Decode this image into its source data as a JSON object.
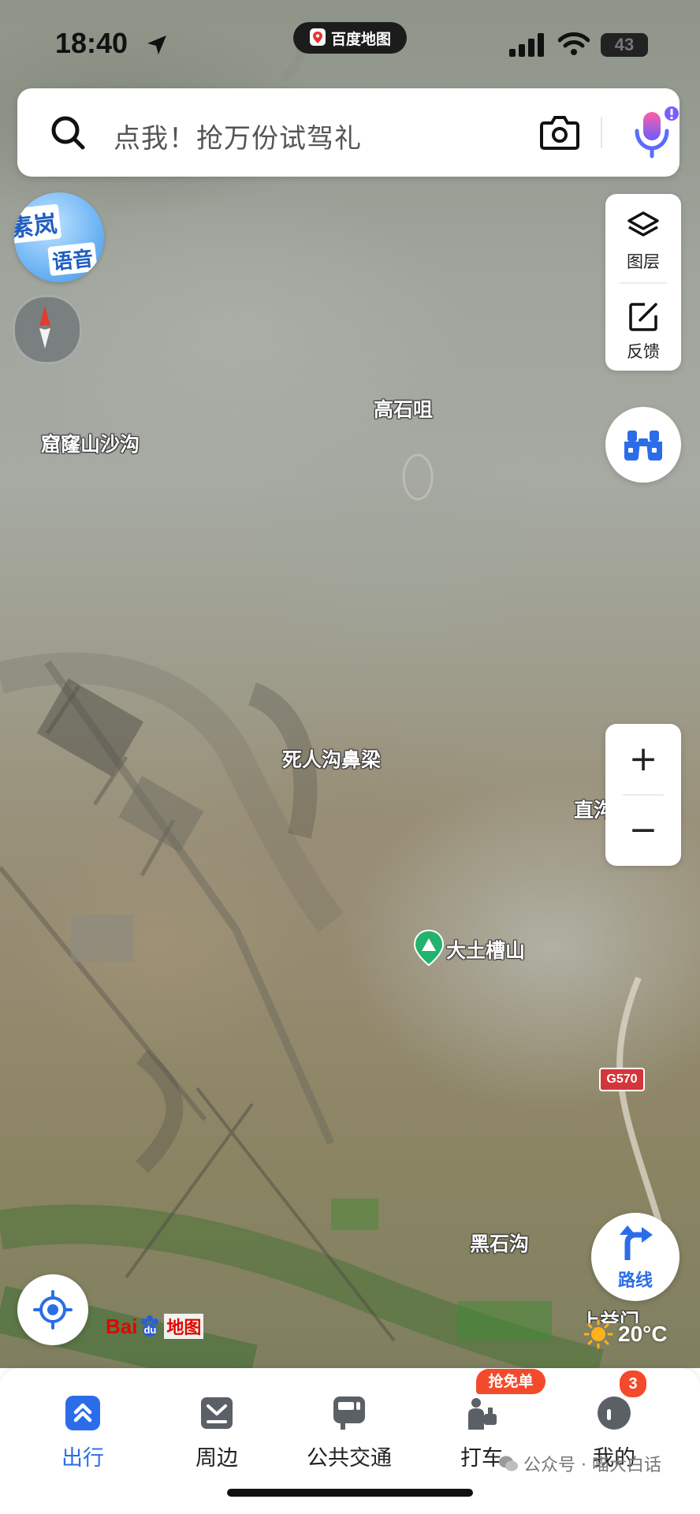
{
  "status_bar": {
    "time": "18:40",
    "battery": "43",
    "app_pill_label": "百度地图"
  },
  "search": {
    "placeholder": "点我！抢万份试驾礼"
  },
  "voice_bubble": {
    "line1": "素岚",
    "line2": "语音"
  },
  "layer_panel": {
    "layers_label": "图层",
    "feedback_label": "反馈"
  },
  "zoom": {
    "in_label": "+",
    "out_label": "−"
  },
  "route_button": {
    "label": "路线"
  },
  "map_labels": {
    "gaoshiju": "高石咀",
    "kulongshan": "窟窿山沙沟",
    "sirengou": "死人沟鼻梁",
    "zhi": "直沟",
    "datucaoshan": "大土槽山",
    "heishigou": "黑石沟",
    "shangyimen": "上益门",
    "road_shield": "G570"
  },
  "logo": {
    "part1": "Bai",
    "part2": "du",
    "part3": "地图"
  },
  "weather": {
    "temperature": "20°C"
  },
  "tabs": [
    {
      "label": "出行",
      "active": true
    },
    {
      "label": "周边",
      "active": false
    },
    {
      "label": "公共交通",
      "active": false
    },
    {
      "label": "打车",
      "active": false
    },
    {
      "label": "我的",
      "active": false
    }
  ],
  "badges": {
    "taxi": "抢免单",
    "messages": "3"
  },
  "watermark": {
    "text": "公众号 · 喵大白话"
  },
  "colors": {
    "accent": "#2b6de8",
    "badge": "#f44a2c"
  }
}
